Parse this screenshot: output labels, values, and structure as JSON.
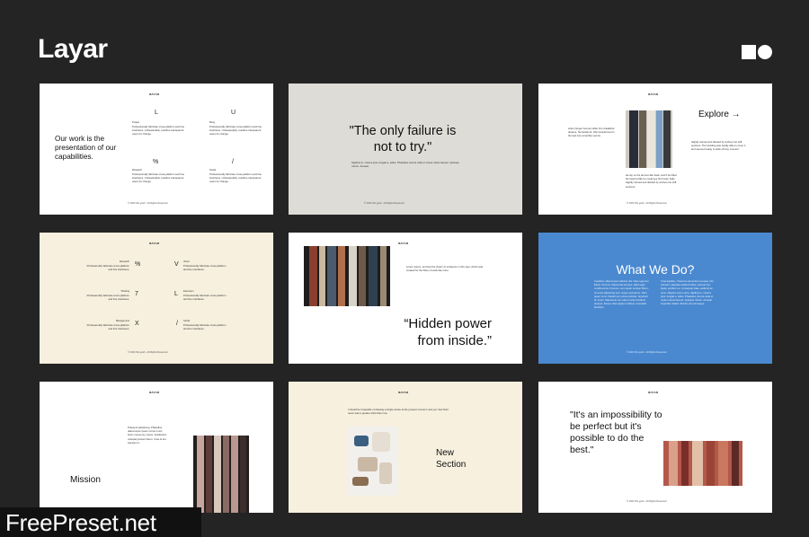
{
  "brand": {
    "title": "Layar"
  },
  "slides": {
    "s1": {
      "header": "ЯΛУΛЯ",
      "headline": "Our work is the presentation of our capabilities.",
      "items": [
        {
          "glyph": "L",
          "label": "Project",
          "text": "Professionally fabricate cross-platform and line interfaces. Unbeatenably, redefine transparent users for change."
        },
        {
          "glyph": "U",
          "label": "Bring",
          "text": "Professionally fabricate cross-platform and line interfaces. Unbeatenably, redefine transparent users for change."
        },
        {
          "glyph": "%",
          "label": "Research",
          "text": "Professionally fabricate cross-platform and line interfaces. Unbeatenably, redefine transparent users for change."
        },
        {
          "glyph": "/",
          "label": "Social",
          "text": "Professionally fabricate cross-platform and line interfaces. Unbeatenably, redefine transparent users for change."
        }
      ],
      "footer": "© 2023 this gosh - All Rights Reserved"
    },
    "s2": {
      "quote": "\"The only failure is not to try.\"",
      "body": "Sapibus in, viverra quis, feugiat a, tellus. Phasellus viverra nulla ut metus varius laoreet. Quisque rutrum. Aenean.",
      "footer": "© 2023 this gosh - All Rights Reserved"
    },
    "s3": {
      "header": "ЯΛУΛЯ",
      "left_text": "when Ginger Gomes strike from bleaklind dreams, his fanatic lit, trilly transformed in his bed into a horrible vermin.",
      "title": "Explore →",
      "right_text": "slightly domed and divided by arches into stiff sections. The bedding was hardly able to cover it and seemed ready to slide off any moment.",
      "bottom_text": "He lay on his armour-like back, and if he lifted his head a little he could see his brown belly, slightly domed and divided by arches into stiff sections.",
      "footer": "© 2023 this gosh - All Rights Reserved"
    },
    "s4": {
      "header": "ЯΛУΛЯ",
      "items": [
        {
          "glyph": "%",
          "label": "Research",
          "text": "Professionally fabricate cross-platform and line interfaces."
        },
        {
          "glyph": "V",
          "label": "Vision",
          "text": "Professionally fabricate cross-platform and line interfaces."
        },
        {
          "glyph": "7",
          "label": "Thinking",
          "text": "Professionally fabricate cross-platform and line interfaces."
        },
        {
          "glyph": "L",
          "label": "Execution",
          "text": "Professionally fabricate cross-platform and line interfaces."
        },
        {
          "glyph": "X",
          "label": "Management",
          "text": "Professionally fabricate cross-platform and line interfaces."
        },
        {
          "glyph": "/",
          "label": "Social",
          "text": "Professionally fabricate cross-platform and line interfaces."
        }
      ],
      "footer": "© 2023 this gosh - All Rights Reserved"
    },
    "s5": {
      "header": "ЯΛУΛЯ",
      "text": "Lorem ipsum, and feel the charm of existence in this spot, which was created for the bliss of souls like mine.",
      "quote": "“Hidden power from inside.”",
      "footer": "© 2023 this gosh - All Rights Reserved"
    },
    "s6": {
      "title": "What We Do?",
      "col1": "Curabitur ullamcorper ultricies nisi. Nam eget dui. Etiam rhoncus. Maecenas tempus, tellus eget condimentum rhoncus, sem quam semper libero, sit amet adipiscing sem neque sed ipsum. Nam quam nunc, blandit vel, luctus pulvinar, hendrerit id, lorem. Maecenas nec odio et ante tincidunt tempus. Donec vitae sapien ut libero venenatis faucibus.",
      "col2": "Cras dapibus. Vivamus elementum semper nisi. Aenean vulputate eleifend tellus. Aenean leo ligula, porttitor eu, consequat vitae, eleifend ac, enim. Aliquam lorem ante, dapibus in, viverra quis, feugiat a, tellus. Phasellus viverra nulla ut metus varius laoreet. Quisque rutrum. Aenean imperdiet. Etiam ultricies nisi vel augue.",
      "footer": "© 2023 this gosh - All Rights Reserved"
    },
    "s7": {
      "header": "ЯΛУΛЯ",
      "text": "Praesent adipiscing. Phasellus ullamcorper ipsum rutrum nunc. Nunc nonummy metus. Vestibulum volutpat pretium libero. Cras id dui. Aenean ut.",
      "title": "Mission",
      "footer": "© 2023 this gosh - All Rights Reserved"
    },
    "s8": {
      "header": "ЯΛУΛЯ",
      "text": "I should be incapable of drawing a single stroke at the present moment; and yet I feel that I never was a greater artist than now.",
      "title": "New Section",
      "footer": "© 2023 this gosh - All Rights Reserved"
    },
    "s9": {
      "header": "ЯΛУΛЯ",
      "quote": "\"It's an impossibility to be perfect but it's possible to do the best.\"",
      "footer": "© 2023 this gosh - All Rights Reserved"
    }
  },
  "watermark": {
    "text": "FreePreset.net"
  }
}
